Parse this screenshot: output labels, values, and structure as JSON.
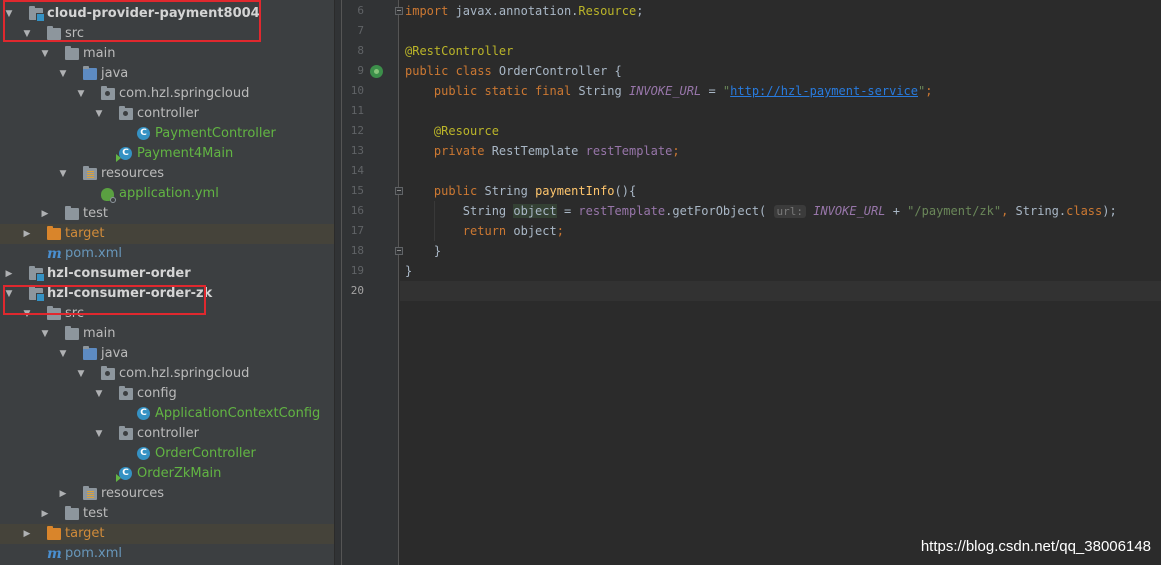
{
  "project_tree": {
    "rows": [
      {
        "label": "cloud-provider-payment8004",
        "depth": 0,
        "arrow": "down",
        "icon": "module-folder-icon",
        "style": "bold"
      },
      {
        "label": "src",
        "depth": 1,
        "arrow": "down",
        "icon": "folder-icon",
        "style": ""
      },
      {
        "label": "main",
        "depth": 2,
        "arrow": "down",
        "icon": "folder-icon",
        "style": ""
      },
      {
        "label": "java",
        "depth": 3,
        "arrow": "down",
        "icon": "source-folder-icon",
        "style": ""
      },
      {
        "label": "com.hzl.springcloud",
        "depth": 4,
        "arrow": "down",
        "icon": "package-icon",
        "style": ""
      },
      {
        "label": "controller",
        "depth": 5,
        "arrow": "down",
        "icon": "package-icon",
        "style": ""
      },
      {
        "label": "PaymentController",
        "depth": 6,
        "arrow": "",
        "icon": "class-icon",
        "style": "green"
      },
      {
        "label": "Payment4Main",
        "depth": 5,
        "arrow": "",
        "icon": "spring-boot-main-icon",
        "style": "green"
      },
      {
        "label": "resources",
        "depth": 3,
        "arrow": "down",
        "icon": "resources-folder-icon",
        "style": ""
      },
      {
        "label": "application.yml",
        "depth": 4,
        "arrow": "",
        "icon": "yml-file-icon",
        "style": "green"
      },
      {
        "label": "test",
        "depth": 2,
        "arrow": "right",
        "icon": "folder-icon",
        "style": ""
      },
      {
        "label": "target",
        "depth": 1,
        "arrow": "right",
        "icon": "excluded-folder-icon",
        "style": "orange",
        "excluded": true
      },
      {
        "label": "pom.xml",
        "depth": 1,
        "arrow": "",
        "icon": "maven-icon",
        "style": "blue"
      },
      {
        "label": "hzl-consumer-order",
        "depth": 0,
        "arrow": "right",
        "icon": "module-folder-icon",
        "style": "bold"
      },
      {
        "label": "hzl-consumer-order-zk",
        "depth": 0,
        "arrow": "down",
        "icon": "module-folder-icon",
        "style": "bold"
      },
      {
        "label": "src",
        "depth": 1,
        "arrow": "down",
        "icon": "folder-icon",
        "style": ""
      },
      {
        "label": "main",
        "depth": 2,
        "arrow": "down",
        "icon": "folder-icon",
        "style": ""
      },
      {
        "label": "java",
        "depth": 3,
        "arrow": "down",
        "icon": "source-folder-icon",
        "style": ""
      },
      {
        "label": "com.hzl.springcloud",
        "depth": 4,
        "arrow": "down",
        "icon": "package-icon",
        "style": ""
      },
      {
        "label": "config",
        "depth": 5,
        "arrow": "down",
        "icon": "package-icon",
        "style": ""
      },
      {
        "label": "ApplicationContextConfig",
        "depth": 6,
        "arrow": "",
        "icon": "class-icon",
        "style": "green"
      },
      {
        "label": "controller",
        "depth": 5,
        "arrow": "down",
        "icon": "package-icon",
        "style": ""
      },
      {
        "label": "OrderController",
        "depth": 6,
        "arrow": "",
        "icon": "class-icon",
        "style": "green"
      },
      {
        "label": "OrderZkMain",
        "depth": 5,
        "arrow": "",
        "icon": "spring-boot-main-icon",
        "style": "green"
      },
      {
        "label": "resources",
        "depth": 3,
        "arrow": "right",
        "icon": "resources-folder-icon",
        "style": ""
      },
      {
        "label": "test",
        "depth": 2,
        "arrow": "right",
        "icon": "folder-icon",
        "style": ""
      },
      {
        "label": "target",
        "depth": 1,
        "arrow": "right",
        "icon": "excluded-folder-icon",
        "style": "orange",
        "excluded": true
      },
      {
        "label": "pom.xml",
        "depth": 1,
        "arrow": "",
        "icon": "maven-icon",
        "style": "blue"
      }
    ],
    "class_icon_letter": "C"
  },
  "editor": {
    "line_numbers": [
      "6",
      "7",
      "8",
      "9",
      "10",
      "11",
      "12",
      "13",
      "14",
      "15",
      "16",
      "17",
      "18",
      "19",
      "20"
    ],
    "current_line": "20",
    "lines": [
      [
        [
          "kw",
          "import "
        ],
        [
          "",
          "javax.annotation."
        ],
        [
          "ann",
          "Resource"
        ],
        [
          "",
          ";"
        ]
      ],
      [],
      [
        [
          "ann",
          "@RestController"
        ]
      ],
      [
        [
          "kw",
          "public class "
        ],
        [
          "",
          "OrderController {"
        ]
      ],
      [
        [
          "",
          "    "
        ],
        [
          "kw",
          "public static final "
        ],
        [
          "",
          "String "
        ],
        [
          "fldi",
          "INVOKE_URL"
        ],
        [
          "",
          " = "
        ],
        [
          "str",
          "\""
        ],
        [
          "url",
          "http://hzl-payment-service"
        ],
        [
          "str",
          "\""
        ],
        [
          "kw",
          ";"
        ]
      ],
      [],
      [
        [
          "",
          "    "
        ],
        [
          "ann",
          "@Resource"
        ]
      ],
      [
        [
          "",
          "    "
        ],
        [
          "kw",
          "private "
        ],
        [
          "",
          "RestTemplate "
        ],
        [
          "fld",
          "restTemplate"
        ],
        [
          "kw",
          ";"
        ]
      ],
      [],
      [
        [
          "",
          "    "
        ],
        [
          "kw",
          "public "
        ],
        [
          "",
          "String "
        ],
        [
          "mth",
          "paymentInfo"
        ],
        [
          "",
          "(){"
        ]
      ],
      [
        [
          "",
          "        String "
        ],
        [
          "hl",
          "object"
        ],
        [
          "",
          " = "
        ],
        [
          "fld",
          "restTemplate"
        ],
        [
          "",
          ".getForObject( "
        ],
        [
          "hint",
          "url:"
        ],
        [
          "",
          " "
        ],
        [
          "fldi",
          "INVOKE_URL"
        ],
        [
          "",
          " + "
        ],
        [
          "str",
          "\"/payment/zk\""
        ],
        [
          "kw",
          ", "
        ],
        [
          "",
          "String."
        ],
        [
          "kw",
          "class"
        ],
        [
          "",
          ");"
        ]
      ],
      [
        [
          "",
          "        "
        ],
        [
          "kw",
          "return "
        ],
        [
          "",
          "object"
        ],
        [
          "kw",
          ";"
        ]
      ],
      [
        [
          "",
          "    }"
        ]
      ],
      [
        [
          "",
          "}"
        ]
      ],
      []
    ]
  },
  "watermark": "https://blog.csdn.net/qq_38006148"
}
